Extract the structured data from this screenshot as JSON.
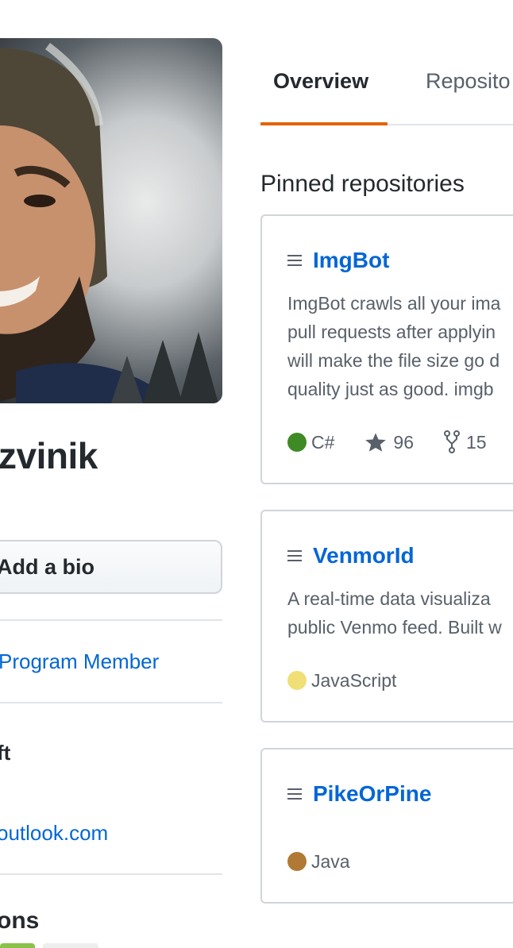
{
  "profile": {
    "name_visible": "zvinik",
    "bio_button_label": "Add a bio",
    "program_link": "Program Member",
    "company": "ft",
    "email": "outlook.com",
    "organizations_heading": "ons"
  },
  "tabs": [
    {
      "label": "Overview",
      "active": true
    },
    {
      "label": "Reposito",
      "active": false
    }
  ],
  "pinned": {
    "title": "Pinned repositories",
    "repos": [
      {
        "name": "ImgBot",
        "description_lines": [
          "ImgBot crawls all your ima",
          "pull requests after applyin",
          "will make the file size go d",
          "quality just as good. imgb"
        ],
        "language": "C#",
        "language_color": "#178600",
        "stars": "96",
        "forks": "15"
      },
      {
        "name": "VenmorId",
        "description_lines": [
          "A real-time data visualiza",
          "public Venmo feed. Built w"
        ],
        "language": "JavaScript",
        "language_color": "#f1e05a"
      },
      {
        "name": "PikeOrPine",
        "description_lines": [],
        "language": "Java",
        "language_color": "#b07219"
      }
    ]
  },
  "colors": {
    "accent_tab": "#e36209",
    "link": "#0366d6"
  }
}
